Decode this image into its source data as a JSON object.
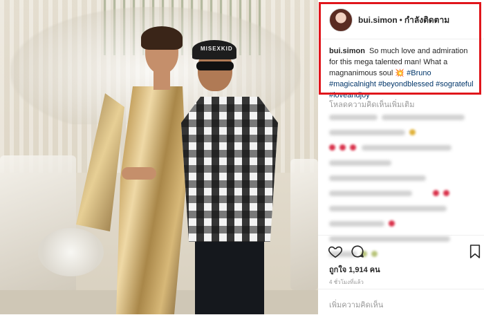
{
  "header": {
    "username": "bui.simon",
    "separator": "•",
    "follow_label": "กำลังติดตาม"
  },
  "caption": {
    "username": "bui.simon",
    "text": "So much love and admiration for this mega talented man! What a magnanimous soul",
    "emoji": "💥",
    "hashtags": [
      "#Bruno",
      "#magicalnight",
      "#beyondblessed",
      "#sograteful",
      "#loveandjoy"
    ]
  },
  "comments": {
    "load_more": "โหลดความคิดเห็นเพิ่มเติม"
  },
  "photo": {
    "cap_text": "MISEXKID"
  },
  "actions": {
    "likes": "ถูกใจ 1,914 คน"
  },
  "time": "4 ชั่วโมงที่แล้ว",
  "add_comment": {
    "placeholder": "เพิ่มความคิดเห็น"
  },
  "colors": {
    "highlight_border": "#e0151b",
    "hashtag": "#003569",
    "muted": "#999999"
  },
  "icons": [
    "heart-icon",
    "comment-icon",
    "bookmark-icon"
  ]
}
